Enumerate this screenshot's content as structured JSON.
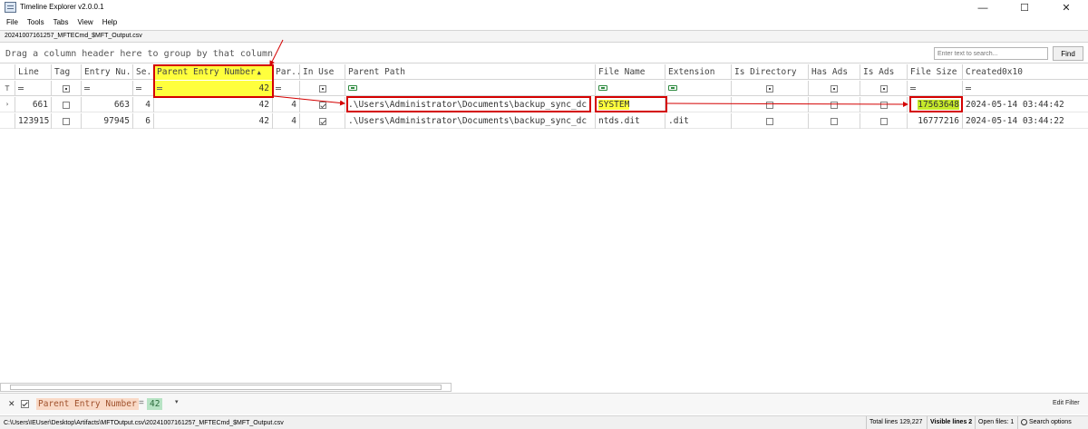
{
  "window": {
    "title": "Timeline Explorer v2.0.0.1",
    "min": "—",
    "max": "☐",
    "close": "✕"
  },
  "menu": [
    "File",
    "Tools",
    "Tabs",
    "View",
    "Help"
  ],
  "file_tab": "20241007161257_MFTECmd_$MFT_Output.csv",
  "group_hint": "Drag a column header here to group by that column",
  "search": {
    "placeholder": "Enter text to search...",
    "find_label": "Find"
  },
  "columns": [
    "Line",
    "Tag",
    "Entry Nu...",
    "Se...",
    "Parent Entry Number",
    "Par...",
    "In Use",
    "Parent Path",
    "File Name",
    "Extension",
    "Is Directory",
    "Has Ads",
    "Is Ads",
    "File Size",
    "Created0x10"
  ],
  "filter_row": {
    "parent_entry_value": "42",
    "equals": "="
  },
  "rows": [
    {
      "indicator": "›",
      "line": "661",
      "entry": "663",
      "seq": "4",
      "parent_entry": "42",
      "par": "4",
      "in_use": true,
      "parent_path": ".\\Users\\Administrator\\Documents\\backup_sync_dc",
      "file_name": "SYSTEM",
      "extension": "",
      "is_directory": false,
      "has_ads": false,
      "is_ads": false,
      "file_size": "17563648",
      "created": "2024-05-14 03:44:42"
    },
    {
      "indicator": "",
      "line": "123915",
      "entry": "97945",
      "seq": "6",
      "parent_entry": "42",
      "par": "4",
      "in_use": true,
      "parent_path": ".\\Users\\Administrator\\Documents\\backup_sync_dc",
      "file_name": "ntds.dit",
      "extension": ".dit",
      "is_directory": false,
      "has_ads": false,
      "is_ads": false,
      "file_size": "16777216",
      "created": "2024-05-14 03:44:22"
    }
  ],
  "filter_bar": {
    "close": "✕",
    "field": "Parent Entry Number",
    "op": "=",
    "value": "42",
    "dropdown": "▾",
    "edit_filter": "Edit Filter"
  },
  "status": {
    "path": "C:\\Users\\IEUser\\Desktop\\Artifacts\\MFTOutput.csv\\20241007161257_MFTECmd_$MFT_Output.csv",
    "total_lines": "Total lines 129,227",
    "visible_lines": "Visible lines 2",
    "open_files": "Open files: 1",
    "search_options": "Search options"
  },
  "colors": {
    "highlight_yellow": "#ffff3d",
    "annotation_red": "#d40000",
    "highlight_green": "#c6e92a"
  }
}
